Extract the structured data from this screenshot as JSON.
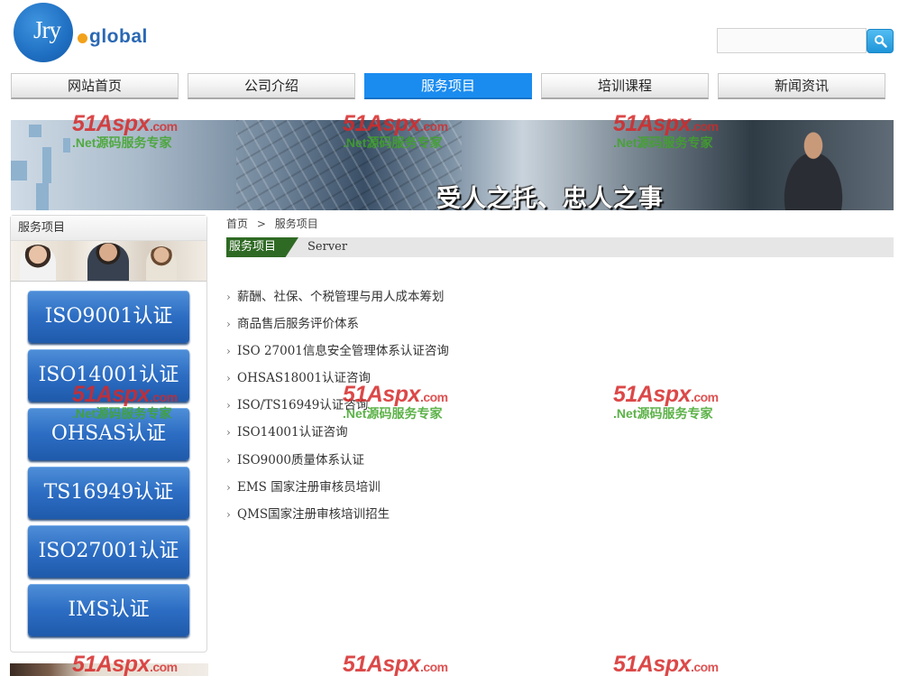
{
  "logo": {
    "left": "Jry",
    "right": "global"
  },
  "search": {
    "placeholder": ""
  },
  "nav": {
    "items": [
      {
        "label": "网站首页"
      },
      {
        "label": "公司介绍"
      },
      {
        "label": "服务项目",
        "active": true
      },
      {
        "label": "培训课程"
      },
      {
        "label": "新闻资讯"
      }
    ]
  },
  "banner": {
    "slogan": "受人之托、忠人之事"
  },
  "sidebar": {
    "title": "服务项目",
    "buttons": [
      "ISO9001认证",
      "ISO14001认证",
      "OHSAS认证",
      "TS16949认证",
      "ISO27001认证",
      "IMS认证"
    ]
  },
  "breadcrumb": {
    "home": "首页",
    "sep": ">",
    "current": "服务项目"
  },
  "section": {
    "title": "服务项目",
    "subtitle": "Server"
  },
  "services": [
    "薪酬、社保、个税管理与用人成本筹划",
    "商品售后服务评价体系",
    "ISO 27001信息安全管理体系认证咨询",
    "OHSAS18001认证咨询",
    "ISO/TS16949认证咨询",
    "ISO14001认证咨询",
    "ISO9000质量体系认证",
    "EMS 国家注册审核员培训",
    "QMS国家注册审核培训招生"
  ],
  "watermark": {
    "brand": "51Aspx",
    "domain": ".com",
    "tagline": ".Net源码服务专家"
  },
  "colors": {
    "nav_active": "#1a8cf0",
    "section_tab": "#2f6a24",
    "button_blue": "#2c6dc3"
  }
}
